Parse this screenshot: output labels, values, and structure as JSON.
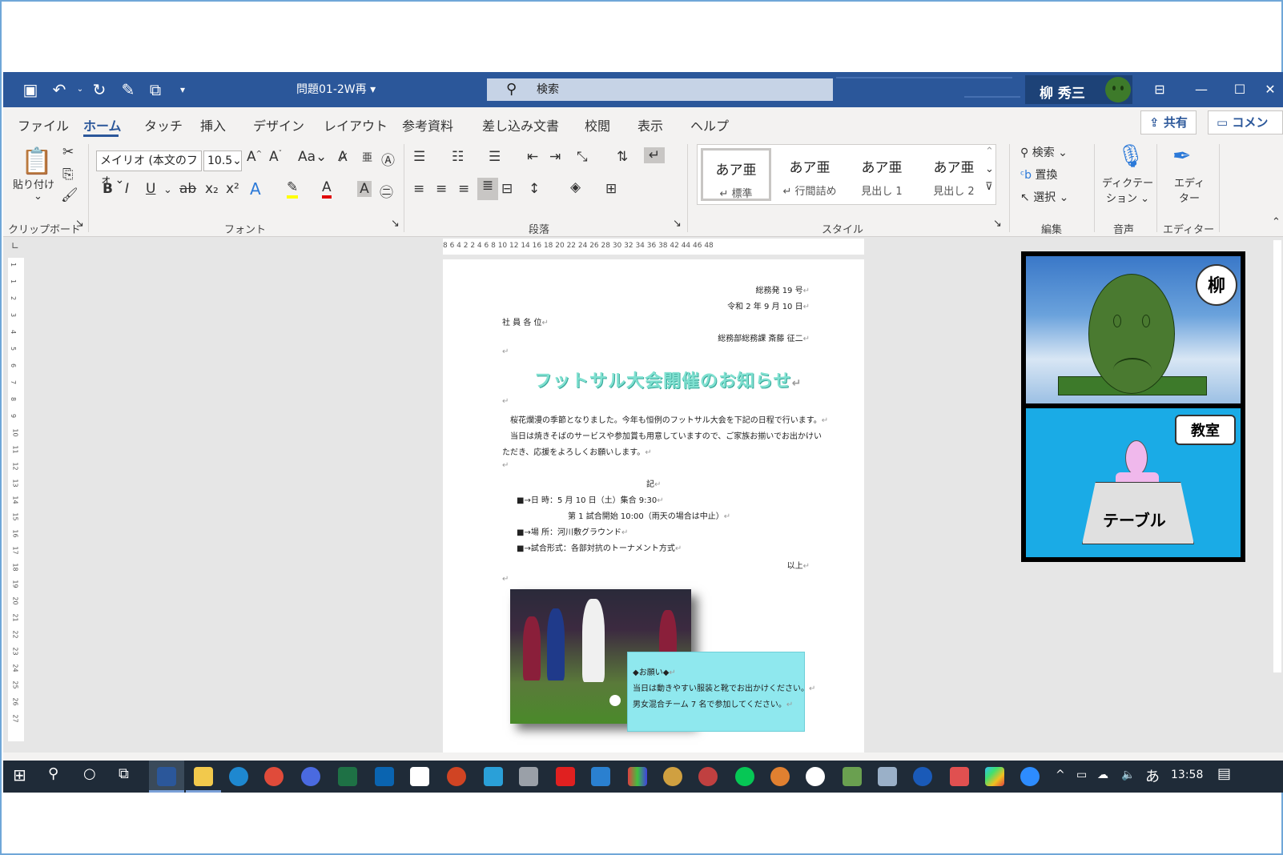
{
  "titlebar": {
    "doc_title": "問題01-2W再",
    "search_placeholder": "検索",
    "user_name": "柳 秀三"
  },
  "tabs": [
    "ファイル",
    "ホーム",
    "タッチ",
    "挿入",
    "デザイン",
    "レイアウト",
    "参考資料",
    "差し込み文書",
    "校閲",
    "表示",
    "ヘルプ"
  ],
  "active_tab": "ホーム",
  "header_buttons": {
    "share": "共有",
    "comment": "コメント"
  },
  "ribbon": {
    "clipboard": {
      "paste": "貼り付け",
      "group": "クリップボード"
    },
    "font": {
      "name": "メイリオ (本文のフォ",
      "size": "10.5",
      "case": "Aa",
      "group": "フォント"
    },
    "paragraph": {
      "group": "段落"
    },
    "styles": {
      "group": "スタイル",
      "items": [
        {
          "sample": "あア亜",
          "label": "↵ 標準"
        },
        {
          "sample": "あア亜",
          "label": "↵ 行間詰め"
        },
        {
          "sample": "あア亜",
          "label": "見出し 1"
        },
        {
          "sample": "あア亜",
          "label": "見出し 2"
        }
      ]
    },
    "editing": {
      "find": "検索",
      "replace": "置換",
      "select": "選択",
      "group": "編集"
    },
    "voice": {
      "dictate_1": "ディクテー",
      "dictate_2": "ション",
      "group": "音声"
    },
    "editor": {
      "label_1": "エディ",
      "label_2": "ター",
      "group": "エディター"
    }
  },
  "ruler": {
    "horizontal": "8  6  4  2        2   4   6   8  10  12  14  16  18  20  22  24  26  28  30  32  34  36  38        42  44  46  48",
    "vertical": [
      "1",
      "1",
      "2",
      "3",
      "4",
      "5",
      "6",
      "7",
      "8",
      "9",
      "10",
      "11",
      "12",
      "13",
      "14",
      "15",
      "16",
      "17",
      "18",
      "19",
      "20",
      "21",
      "22",
      "23",
      "24",
      "25",
      "26",
      "27"
    ]
  },
  "document": {
    "doc_number": "総務発 19 号",
    "date": "令和 2 年 9 月 10 日",
    "addressee": "社 員 各 位",
    "sender": "総務部総務課  斎藤  征二",
    "heading": "フットサル大会開催のお知らせ",
    "para1": "桜花爛漫の季節となりました。今年も恒例のフットサル大会を下記の日程で行います。",
    "para2": "当日は焼きそばのサービスや参加賞も用意していますので、ご家族お揃いでお出かけい",
    "para3": "ただき、応援をよろしくお願いします。",
    "ki": "記",
    "item1": "■→日      時：5 月 10 日（土）集合 9:30",
    "item1b": "第 1 試合開始  10:00（雨天の場合は中止）",
    "item2": "■→場      所：河川敷グラウンド",
    "item3": "■→試合形式：各部対抗のトーナメント方式",
    "ijo": "以上",
    "note_title": "◆お願い◆",
    "note_line1": "当日は動きやすい服装と靴でお出かけください。",
    "note_line2": "男女混合チーム 7 名で参加してください。"
  },
  "video": {
    "name_tag": "柳",
    "room_tag": "教室",
    "table_label": "テーブル"
  },
  "taskbar": {
    "ime": "あ",
    "time": "13:58"
  },
  "colors": {
    "word_blue": "#2b579a",
    "heading_teal": "#7fe0d0",
    "note_cyan": "#8fe8ee",
    "classroom_blue": "#1aabe6"
  }
}
